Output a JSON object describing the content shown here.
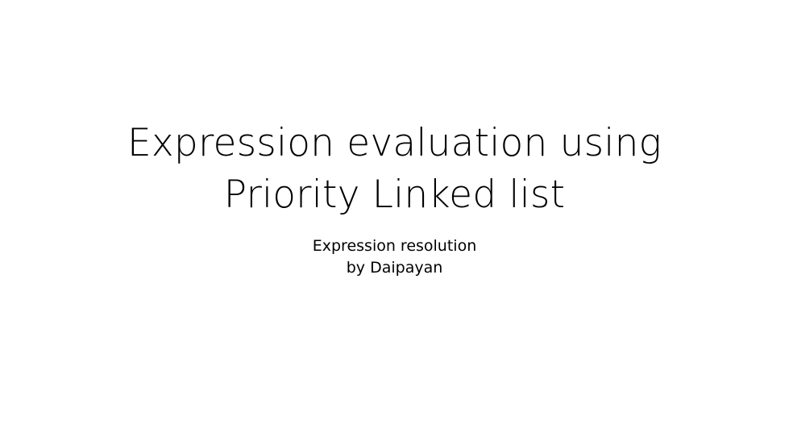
{
  "slide": {
    "title_lines": [
      "Expression evaluation using",
      "Priority Linked list"
    ],
    "subtitle_lines": [
      "Expression resolution",
      "by Daipayan"
    ]
  }
}
